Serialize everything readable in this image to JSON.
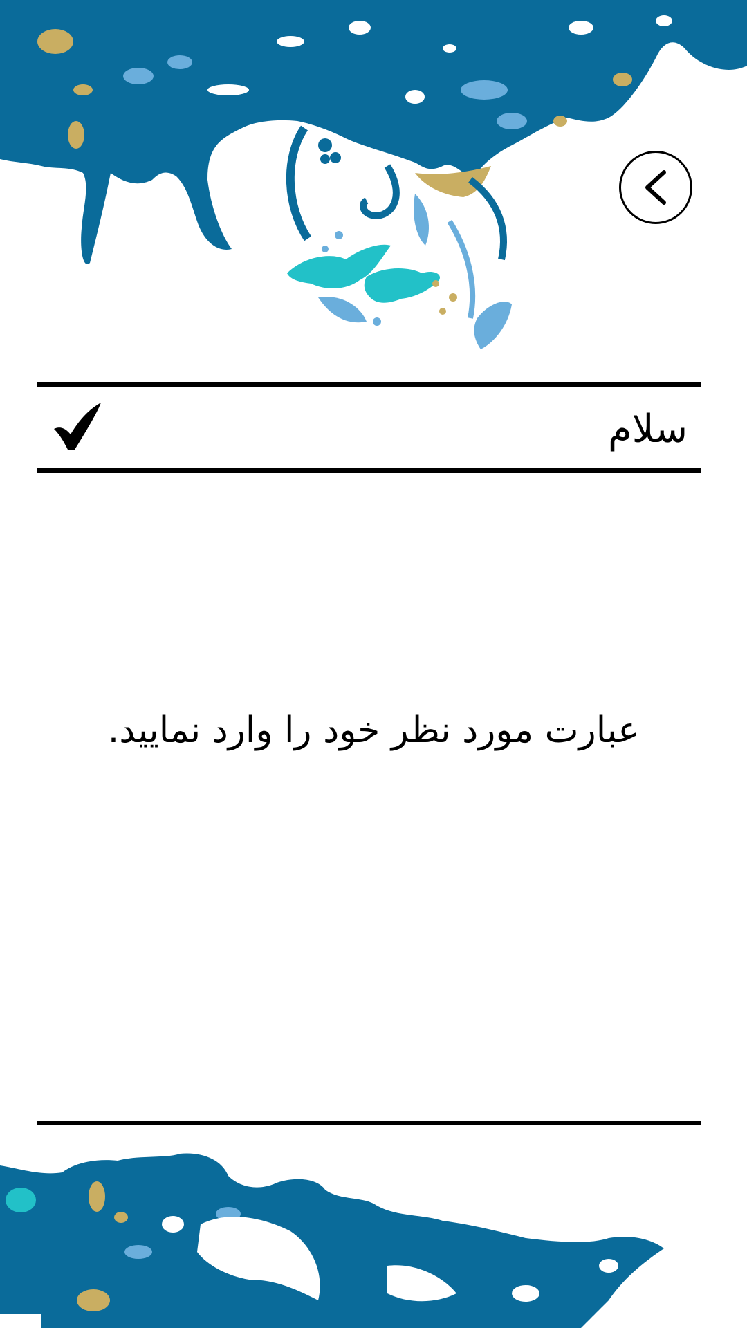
{
  "header": {
    "back_icon": "chevron-left-icon"
  },
  "input": {
    "value": "سلام",
    "confirm_icon": "checkmark-icon"
  },
  "prompt": {
    "text": "عبارت مورد نظر خود را وارد نمایید."
  },
  "colors": {
    "primary_blue": "#0a6b9a",
    "light_blue": "#6aaedc",
    "teal": "#22c1c8",
    "gold": "#c9ae62"
  }
}
